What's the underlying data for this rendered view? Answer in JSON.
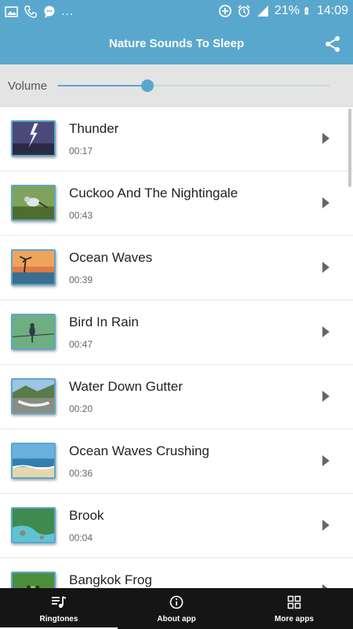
{
  "status_bar": {
    "battery": "21%",
    "time": "14:09",
    "dots": "..."
  },
  "app_bar": {
    "title": "Nature Sounds To Sleep"
  },
  "volume": {
    "label": "Volume",
    "level": 0.33
  },
  "sounds": [
    {
      "title": "Thunder",
      "duration": "00:17"
    },
    {
      "title": "Cuckoo And The Nightingale",
      "duration": "00:43"
    },
    {
      "title": "Ocean Waves",
      "duration": "00:39"
    },
    {
      "title": "Bird In Rain",
      "duration": "00:47"
    },
    {
      "title": "Water Down Gutter",
      "duration": "00:20"
    },
    {
      "title": "Ocean Waves Crushing",
      "duration": "00:36"
    },
    {
      "title": "Brook",
      "duration": "00:04"
    },
    {
      "title": "Bangkok Frog",
      "duration": ""
    }
  ],
  "bottom_nav": {
    "ringtones_label": "Ringtones",
    "about_label": "About app",
    "more_label": "More apps"
  },
  "colors": {
    "accent": "#5aa7cd",
    "nav_bg": "#151515",
    "volume_bg": "#e4e4e4"
  }
}
